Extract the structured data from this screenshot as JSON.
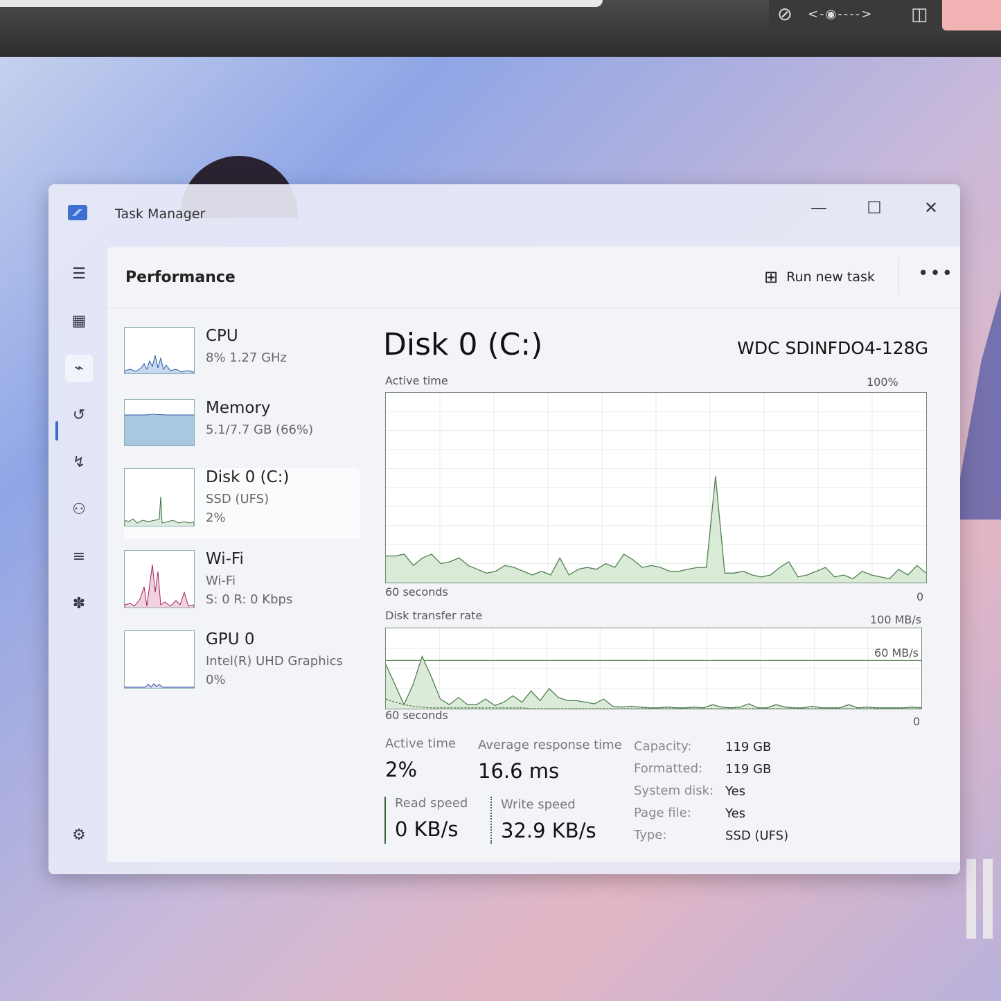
{
  "window": {
    "title": "Task Manager"
  },
  "header": {
    "title": "Performance",
    "run_new_task": "Run new task"
  },
  "devices": [
    {
      "name": "CPU",
      "line1": "8%  1.27 GHz",
      "line2": ""
    },
    {
      "name": "Memory",
      "line1": "5.1/7.7 GB (66%)",
      "line2": ""
    },
    {
      "name": "Disk 0 (C:)",
      "line1": "SSD (UFS)",
      "line2": "2%"
    },
    {
      "name": "Wi-Fi",
      "line1": "Wi-Fi",
      "line2": "S: 0 R: 0 Kbps"
    },
    {
      "name": "GPU 0",
      "line1": "Intel(R) UHD Graphics",
      "line2": "0%"
    }
  ],
  "panel": {
    "title": "Disk 0 (C:)",
    "model": "WDC SDINFDO4-128G",
    "active_time_label": "Active time",
    "active_time_max": "100%",
    "active_time_seconds": "60 seconds",
    "active_time_zero": "0",
    "transfer_label": "Disk transfer rate",
    "transfer_max": "100 MB/s",
    "transfer_mid": "60 MB/s",
    "transfer_seconds": "60 seconds",
    "transfer_zero": "0"
  },
  "stats": {
    "active_time_label": "Active time",
    "active_time_value": "2%",
    "avg_response_label": "Average response time",
    "avg_response_value": "16.6 ms",
    "read_label": "Read speed",
    "read_value": "0 KB/s",
    "write_label": "Write speed",
    "write_value": "32.9 KB/s"
  },
  "properties": [
    {
      "key": "Capacity:",
      "value": "119 GB"
    },
    {
      "key": "Formatted:",
      "value": "119 GB"
    },
    {
      "key": "System disk:",
      "value": "Yes"
    },
    {
      "key": "Page file:",
      "value": "Yes"
    },
    {
      "key": "Type:",
      "value": "SSD (UFS)"
    }
  ],
  "chart_data": [
    {
      "type": "area",
      "title": "Active time",
      "ylim": [
        0,
        100
      ],
      "series": [
        {
          "values": [
            14,
            14,
            15,
            9,
            13,
            15,
            10,
            11,
            13,
            9,
            7,
            5,
            6,
            9,
            8,
            6,
            4,
            6,
            4,
            13,
            4,
            7,
            8,
            7,
            10,
            8,
            15,
            12,
            8,
            9,
            8,
            6,
            6,
            7,
            8,
            8,
            56,
            5,
            5,
            6,
            4,
            3,
            4,
            8,
            11,
            3,
            4,
            6,
            8,
            3,
            4,
            2,
            6,
            4,
            3,
            2,
            7,
            4,
            9,
            5
          ]
        }
      ]
    },
    {
      "type": "area",
      "title": "Disk transfer rate",
      "ylim": [
        0,
        100
      ],
      "series": [
        {
          "name": "Read speed",
          "values": [
            12,
            8,
            5,
            3,
            2,
            1,
            1,
            1,
            1,
            1,
            1,
            1,
            1,
            1,
            1,
            1,
            0,
            0,
            0,
            0,
            0,
            0,
            0,
            0,
            0,
            0,
            0,
            0,
            0,
            0,
            0,
            0,
            0,
            0,
            0,
            0,
            0,
            0,
            0,
            0,
            0,
            0,
            0,
            0,
            0,
            0,
            0,
            0,
            0,
            0,
            0,
            0,
            0,
            0,
            0,
            0,
            0,
            0,
            0,
            0
          ]
        },
        {
          "name": "Write speed",
          "values": [
            55,
            30,
            5,
            30,
            65,
            40,
            12,
            5,
            14,
            5,
            5,
            12,
            4,
            8,
            16,
            8,
            22,
            10,
            25,
            14,
            10,
            10,
            8,
            6,
            12,
            3,
            2,
            3,
            2,
            1,
            1,
            2,
            1,
            1,
            2,
            1,
            5,
            2,
            1,
            2,
            6,
            1,
            1,
            5,
            2,
            1,
            1,
            3,
            1,
            1,
            1,
            5,
            1,
            2,
            1,
            1,
            1,
            1,
            2,
            1
          ]
        }
      ]
    }
  ]
}
